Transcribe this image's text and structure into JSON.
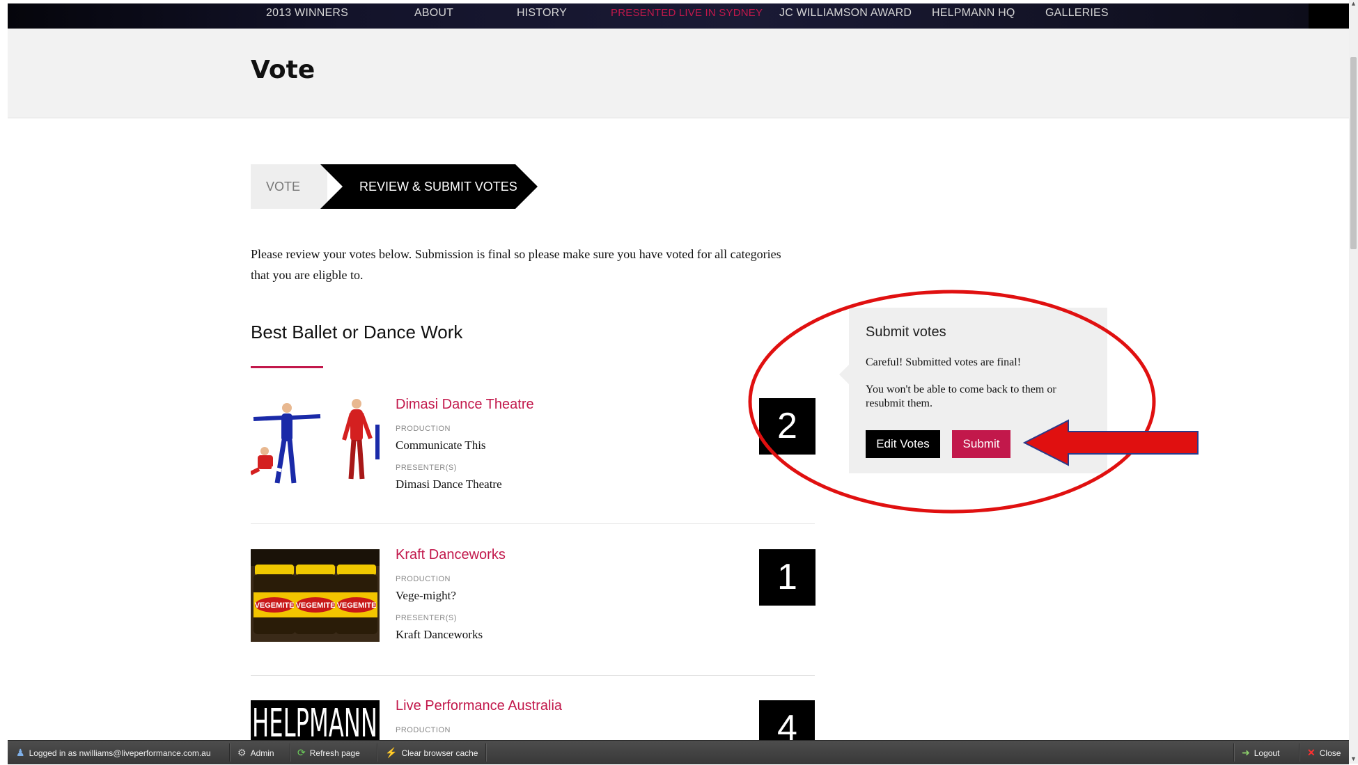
{
  "nav": {
    "items": [
      "2013 WINNERS",
      "ABOUT",
      "HISTORY",
      "PRESENTED LIVE IN SYDNEY",
      "JC WILLIAMSON AWARD",
      "HELPMANN HQ",
      "GALLERIES"
    ]
  },
  "page": {
    "title": "Vote"
  },
  "steps": {
    "vote": "VOTE",
    "review": "REVIEW & SUBMIT VOTES"
  },
  "intro": "Please review your votes below. Submission is final so please make sure you have voted for all categories that you are eligble to.",
  "category": {
    "title": "Best Ballet or Dance Work"
  },
  "entries": [
    {
      "org": "Dimasi Dance Theatre",
      "production_label": "PRODUCTION",
      "production": "Communicate This",
      "presenter_label": "PRESENTER(S)",
      "presenter": "Dimasi Dance Theatre",
      "rank": "2"
    },
    {
      "org": "Kraft Danceworks",
      "production_label": "PRODUCTION",
      "production": "Vege-might?",
      "presenter_label": "PRESENTER(S)",
      "presenter": "Kraft Danceworks",
      "rank": "1"
    },
    {
      "org": "Live Performance Australia",
      "production_label": "PRODUCTION",
      "rank": "4"
    }
  ],
  "thumb_text": {
    "jar": "VEGEMITE",
    "logo": "HELPMANN"
  },
  "popover": {
    "title": "Submit votes",
    "warning": "Careful! Submitted votes are final!",
    "note": "You won't be able to come back to them or resubmit them.",
    "edit_label": "Edit Votes",
    "submit_label": "Submit"
  },
  "toolbar": {
    "logged_in": "Logged in as nwilliams@liveperformance.com.au",
    "admin": "Admin",
    "refresh": "Refresh page",
    "clear_cache": "Clear browser cache",
    "logout": "Logout",
    "close": "Close"
  },
  "colors": {
    "accent": "#c2184b",
    "annotation": "#e01010"
  }
}
